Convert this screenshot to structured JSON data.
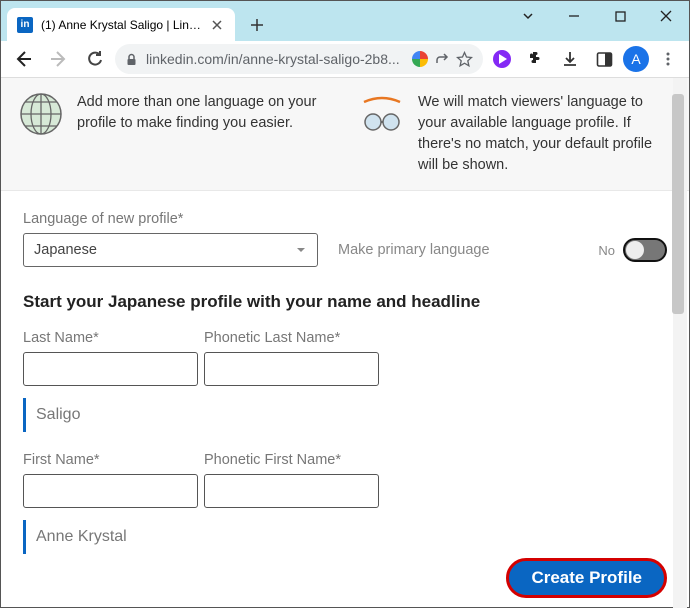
{
  "browser": {
    "tab_title": "(1) Anne Krystal Saligo | LinkedIn",
    "url_display": "linkedin.com/in/anne-krystal-saligo-2b8...",
    "profile_letter": "A"
  },
  "banner": {
    "left_text": "Add more than one language on your profile to make finding you easier.",
    "right_text": "We will match viewers' language to your available language profile. If there's no match, your default profile will be shown."
  },
  "form": {
    "language_label": "Language of new profile*",
    "language_value": "Japanese",
    "primary_label": "Make primary language",
    "primary_state": "No",
    "section_heading": "Start your Japanese profile with your name and headline",
    "last_name_label": "Last Name*",
    "phonetic_last_label": "Phonetic Last Name*",
    "last_name_hint": "Saligo",
    "first_name_label": "First Name*",
    "phonetic_first_label": "Phonetic First Name*",
    "first_name_hint": "Anne Krystal",
    "create_button": "Create Profile"
  }
}
